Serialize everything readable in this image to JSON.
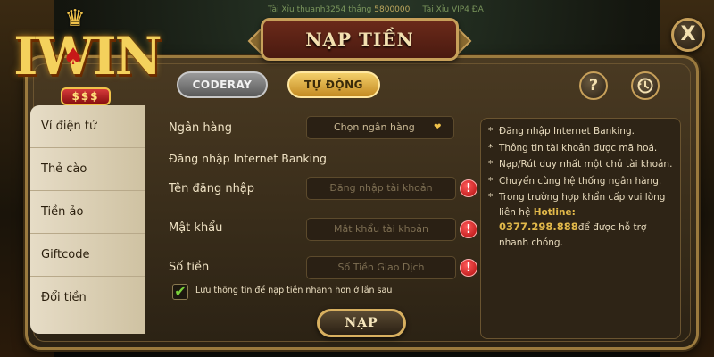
{
  "ticker": {
    "items": [
      {
        "prefix": "Tài Xỉu",
        "user": "thuanh3254",
        "action": "thắng",
        "amount": "5800000"
      },
      {
        "prefix": "Tài Xỉu",
        "user": "VIP4 ĐA",
        "action": "",
        "amount": ""
      }
    ]
  },
  "logo": {
    "text": "IWIN",
    "badge": "$$$"
  },
  "modal": {
    "title": "NẠP TIỀN",
    "close_label": "X"
  },
  "tabs": [
    {
      "label": "CODERAY",
      "active": false
    },
    {
      "label": "TỰ ĐỘNG",
      "active": true
    }
  ],
  "header_buttons": {
    "help": "?",
    "history_icon": "clock-icon"
  },
  "sidebar": {
    "items": [
      {
        "label": "Ví điện tử"
      },
      {
        "label": "Thẻ cào"
      },
      {
        "label": "Tiền ảo"
      },
      {
        "label": "Giftcode"
      },
      {
        "label": "Đổi tiền"
      }
    ]
  },
  "form": {
    "bank_label": "Ngân hàng",
    "bank_select_value": "Chọn ngân hàng",
    "section_label": "Đăng nhập Internet Banking",
    "username_label": "Tên đăng nhập",
    "username_placeholder": "Đăng nhập tài khoản",
    "password_label": "Mật khẩu",
    "password_placeholder": "Mật khẩu tài khoản",
    "amount_label": "Số tiền",
    "amount_placeholder": "Số Tiền Giao Dịch",
    "remember_text": "Lưu thông tin để nạp tiền nhanh hơn ở lần sau",
    "remember_checked": true,
    "submit_label": "NẠP"
  },
  "info": {
    "items": [
      "Đăng nhập Internet Banking.",
      "Thông tin tài khoản được mã hoá.",
      "Nạp/Rút duy nhất một chủ tài khoản.",
      "Chuyển cùng hệ thống ngân hàng.",
      "Trong trường hợp khẩn cấp vui lòng liên hệ"
    ],
    "hotline_label": "Hotline:",
    "hotline_number": "0377.298.888",
    "hotline_suffix": "để được hỗ trợ nhanh chóng."
  },
  "colors": {
    "accent_gold": "#d8b060",
    "active_tab": "#f3cf6a",
    "warning": "#b00c0c",
    "check": "#7ad23a"
  }
}
